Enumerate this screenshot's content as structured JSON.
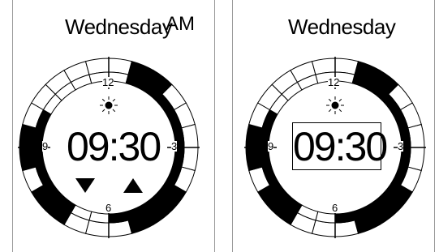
{
  "left_panel": {
    "day": "Wednesday",
    "ampm": "AM",
    "time": "09:30",
    "dial_labels": {
      "twelve": "12",
      "three": "3",
      "six": "6",
      "nine": "9"
    },
    "controls": {
      "decrement": "down-arrow",
      "increment": "up-arrow"
    }
  },
  "right_panel": {
    "day": "Wednesday",
    "time": "09:30",
    "dial_labels": {
      "twelve": "12",
      "three": "3",
      "six": "6",
      "nine": "9"
    }
  },
  "dial": {
    "segments_per_ring": 24,
    "outer_ring_filled": [
      1,
      2,
      8,
      9,
      10,
      14,
      15,
      17,
      18
    ],
    "inner_ring_filled": [
      1,
      2,
      3,
      4,
      5,
      6,
      7,
      8,
      9,
      10,
      11,
      14,
      15,
      16,
      17,
      18,
      19
    ],
    "sun_icon": "sun-icon",
    "fill_color": "#000000",
    "line_color": "#000000"
  }
}
